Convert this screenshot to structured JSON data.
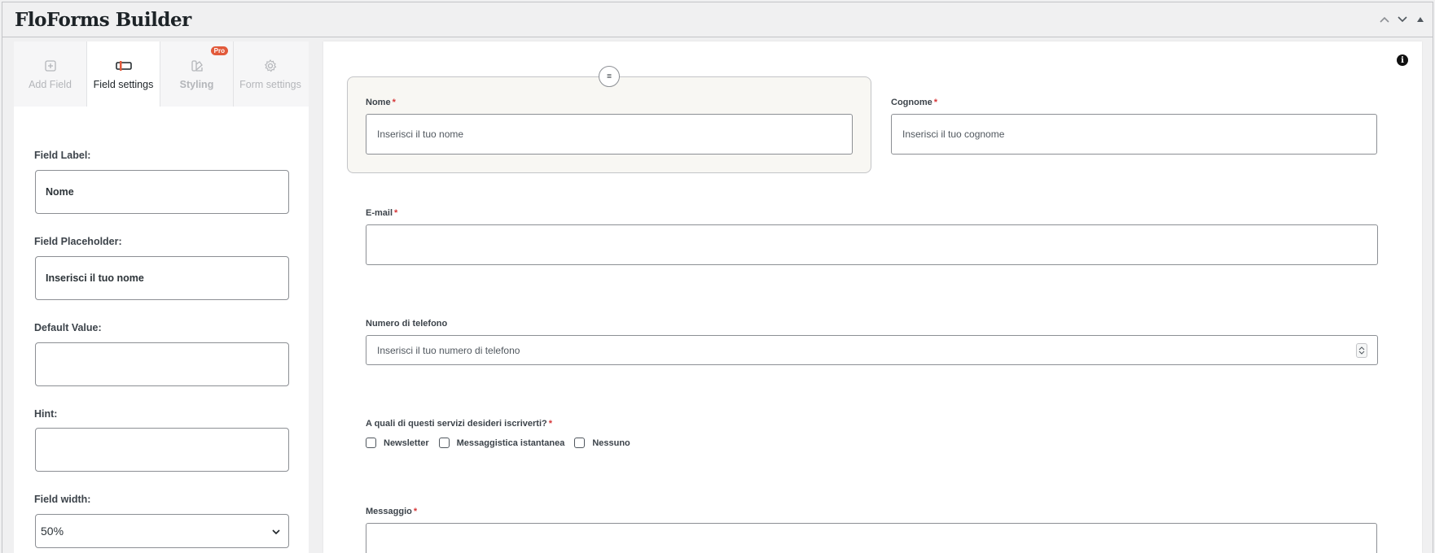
{
  "header": {
    "title": "FloForms Builder",
    "controls": [
      "chevron-up-icon",
      "chevron-down-icon",
      "triangle-up-icon"
    ]
  },
  "tabs": [
    {
      "label": "Add Field",
      "icon": "plus-square-icon",
      "active": false
    },
    {
      "label": "Field settings",
      "icon": "field-settings-icon",
      "active": true
    },
    {
      "label": "Styling",
      "icon": "palette-icon",
      "active": false,
      "badge": "Pro"
    },
    {
      "label": "Form settings",
      "icon": "gear-icon",
      "active": false
    }
  ],
  "settings": {
    "field_label": {
      "label": "Field Label:",
      "value": "Nome"
    },
    "field_placeholder": {
      "label": "Field Placeholder:",
      "value": "Inserisci il tuo nome"
    },
    "default_value": {
      "label": "Default Value:",
      "value": ""
    },
    "hint": {
      "label": "Hint:",
      "value": ""
    },
    "field_width": {
      "label": "Field width:",
      "value": "50%"
    }
  },
  "form": {
    "drag_handle": "=",
    "nome": {
      "label": "Nome",
      "required": "*",
      "placeholder": "Inserisci il tuo nome"
    },
    "cognome": {
      "label": "Cognome",
      "required": "*",
      "placeholder": "Inserisci il tuo cognome"
    },
    "email": {
      "label": "E-mail",
      "required": "*",
      "placeholder": ""
    },
    "telefono": {
      "label": "Numero di telefono",
      "placeholder": "Inserisci il tuo numero di telefono"
    },
    "servizi": {
      "label": "A quali di questi servizi desideri iscriverti?",
      "required": "*",
      "options": [
        "Newsletter",
        "Messaggistica istantanea",
        "Nessuno"
      ]
    },
    "messaggio": {
      "label": "Messaggio",
      "required": "*"
    }
  },
  "colors": {
    "accent_pro": "#e25a3b",
    "required": "#d63638",
    "selected_field_bg": "#f8f7f3"
  }
}
